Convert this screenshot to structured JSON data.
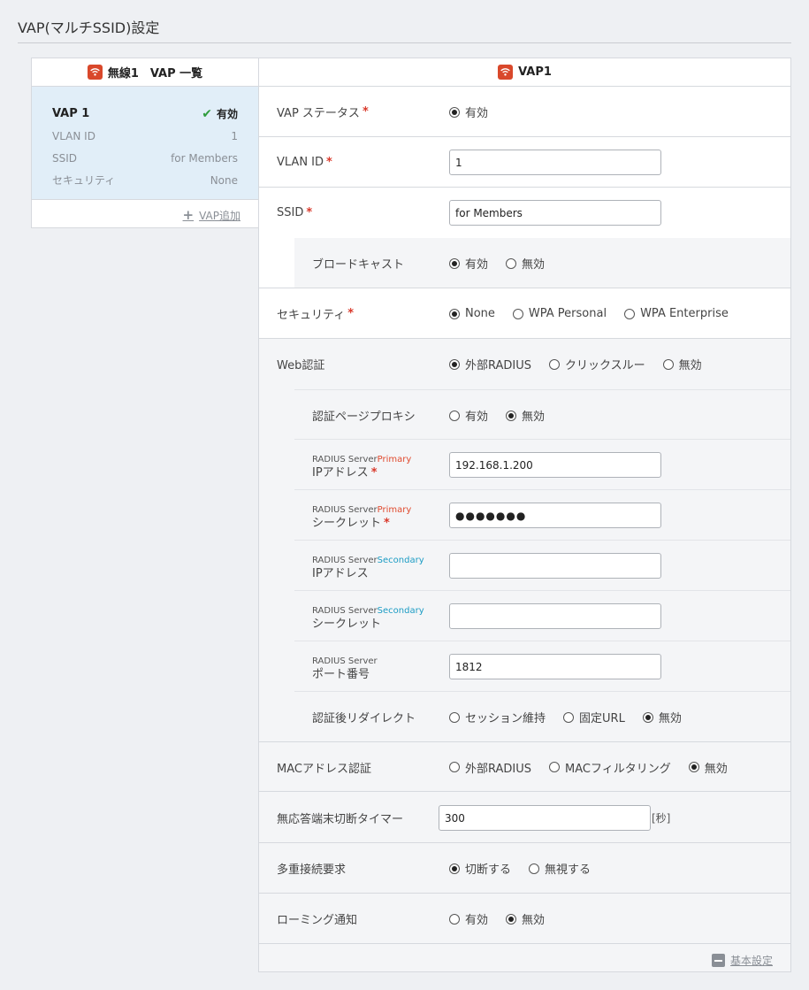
{
  "page": {
    "title": "VAP(マルチSSID)設定"
  },
  "left": {
    "header": "無線1　VAP 一覧",
    "vap": {
      "name": "VAP 1",
      "status": "有効",
      "rows": [
        {
          "label": "VLAN ID",
          "value": "1"
        },
        {
          "label": "SSID",
          "value": "for Members"
        },
        {
          "label": "セキュリティ",
          "value": "None"
        }
      ]
    },
    "add_label": "VAP追加"
  },
  "right": {
    "header": "VAP1",
    "vap_status": {
      "label": "VAP ステータス",
      "options": [
        "有効"
      ],
      "selected": 0
    },
    "vlan_id": {
      "label": "VLAN ID",
      "value": "1"
    },
    "ssid": {
      "label": "SSID",
      "value": "for Members"
    },
    "broadcast": {
      "label": "ブロードキャスト",
      "options": [
        "有効",
        "無効"
      ],
      "selected": 0
    },
    "security": {
      "label": "セキュリティ",
      "options": [
        "None",
        "WPA Personal",
        "WPA Enterprise"
      ],
      "selected": 0
    },
    "web_auth": {
      "label": "Web認証",
      "options": [
        "外部RADIUS",
        "クリックスルー",
        "無効"
      ],
      "selected": 0
    },
    "auth_proxy": {
      "label": "認証ページプロキシ",
      "options": [
        "有効",
        "無効"
      ],
      "selected": 1
    },
    "radius_ip_primary": {
      "small": "RADIUS Server",
      "tag": "Primary",
      "label": "IPアドレス",
      "value": "192.168.1.200"
    },
    "radius_secret_primary": {
      "small": "RADIUS Server",
      "tag": "Primary",
      "label": "シークレット",
      "value": "●●●●●●●"
    },
    "radius_ip_secondary": {
      "small": "RADIUS Server",
      "tag": "Secondary",
      "label": "IPアドレス",
      "value": ""
    },
    "radius_secret_secondary": {
      "small": "RADIUS Server",
      "tag": "Secondary",
      "label": "シークレット",
      "value": ""
    },
    "radius_port": {
      "small": "RADIUS Server",
      "label": "ポート番号",
      "value": "1812"
    },
    "redirect": {
      "label": "認証後リダイレクト",
      "options": [
        "セッション維持",
        "固定URL",
        "無効"
      ],
      "selected": 2
    },
    "mac_auth": {
      "label": "MACアドレス認証",
      "options": [
        "外部RADIUS",
        "MACフィルタリング",
        "無効"
      ],
      "selected": 2
    },
    "timer": {
      "label": "無応答端末切断タイマー",
      "value": "300",
      "unit": "[秒]"
    },
    "multi_conn": {
      "label": "多重接続要求",
      "options": [
        "切断する",
        "無視する"
      ],
      "selected": 0
    },
    "roaming": {
      "label": "ローミング通知",
      "options": [
        "有効",
        "無効"
      ],
      "selected": 1
    },
    "basic_setting_label": "基本設定"
  }
}
